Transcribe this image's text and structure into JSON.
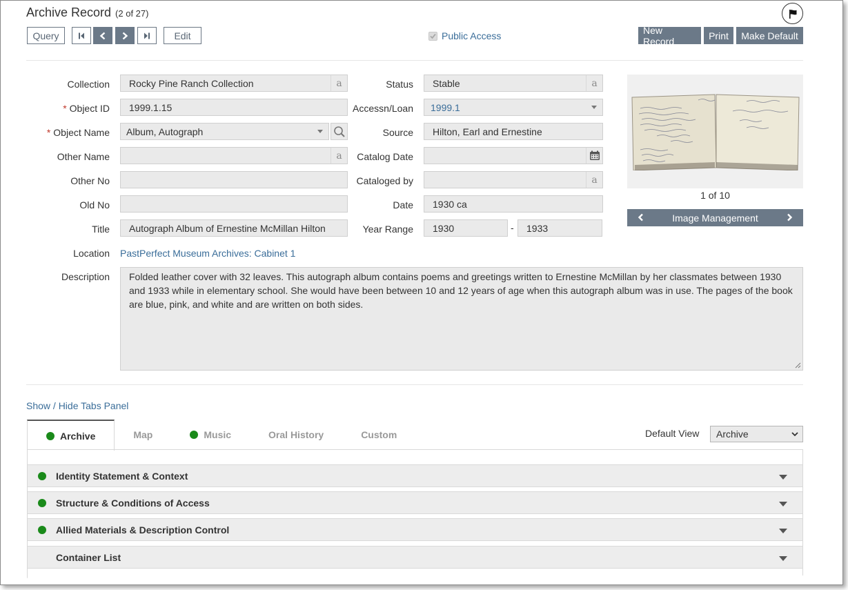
{
  "header": {
    "title": "Archive Record",
    "record_count": "(2 of 27)"
  },
  "toolbar": {
    "query_label": "Query",
    "edit_label": "Edit",
    "public_access_label": "Public Access",
    "public_access_checked": true,
    "new_record_label": "New Record",
    "print_label": "Print",
    "make_default_label": "Make Default"
  },
  "fields": {
    "collection": {
      "label": "Collection",
      "value": "Rocky Pine Ranch Collection"
    },
    "object_id": {
      "label": "Object ID",
      "value": "1999.1.15"
    },
    "object_name": {
      "label": "Object Name",
      "value": "Album, Autograph"
    },
    "other_name": {
      "label": "Other Name",
      "value": ""
    },
    "other_no": {
      "label": "Other No",
      "value": ""
    },
    "old_no": {
      "label": "Old No",
      "value": ""
    },
    "title": {
      "label": "Title",
      "value": "Autograph Album of Ernestine McMillan Hilton"
    },
    "location": {
      "label": "Location",
      "value": "PastPerfect Museum Archives: Cabinet 1"
    },
    "status": {
      "label": "Status",
      "value": "Stable"
    },
    "accessn_loan": {
      "label": "Accessn/Loan",
      "value": "1999.1"
    },
    "source": {
      "label": "Source",
      "value": "Hilton, Earl and Ernestine"
    },
    "catalog_date": {
      "label": "Catalog Date",
      "value": ""
    },
    "cataloged_by": {
      "label": "Cataloged by",
      "value": ""
    },
    "date": {
      "label": "Date",
      "value": "1930 ca"
    },
    "year_range": {
      "label": "Year Range",
      "from": "1930",
      "separator": "-",
      "to": "1933"
    },
    "description": {
      "label": "Description",
      "value": "Folded leather cover with 32 leaves.  This autograph album contains poems and greetings written to Ernestine McMillan by her classmates between 1930 and 1933 while in elementary school. She would have been between 10 and 12 years of age when this autograph album was in use.  The pages of the book are blue, pink, and white and are written on both sides."
    }
  },
  "image_panel": {
    "count": "1 of 10",
    "management_label": "Image Management"
  },
  "tabs_panel": {
    "toggle_label": "Show / Hide Tabs Panel",
    "tabs": [
      {
        "label": "Archive",
        "active": true,
        "has_dot": true
      },
      {
        "label": "Map",
        "active": false,
        "has_dot": false
      },
      {
        "label": "Music",
        "active": false,
        "has_dot": true
      },
      {
        "label": "Oral History",
        "active": false,
        "has_dot": false
      },
      {
        "label": "Custom",
        "active": false,
        "has_dot": false
      }
    ],
    "default_view_label": "Default View",
    "default_view_value": "Archive"
  },
  "sections": [
    {
      "label": "Identity Statement & Context",
      "has_dot": true
    },
    {
      "label": "Structure & Conditions of Access",
      "has_dot": true
    },
    {
      "label": "Allied Materials & Description Control",
      "has_dot": true
    },
    {
      "label": "Container List",
      "has_dot": false
    }
  ],
  "colors": {
    "accent_button": "#6b7988",
    "link": "#3a6d99",
    "status_dot": "#1a8a1a",
    "required": "#c0392b"
  }
}
